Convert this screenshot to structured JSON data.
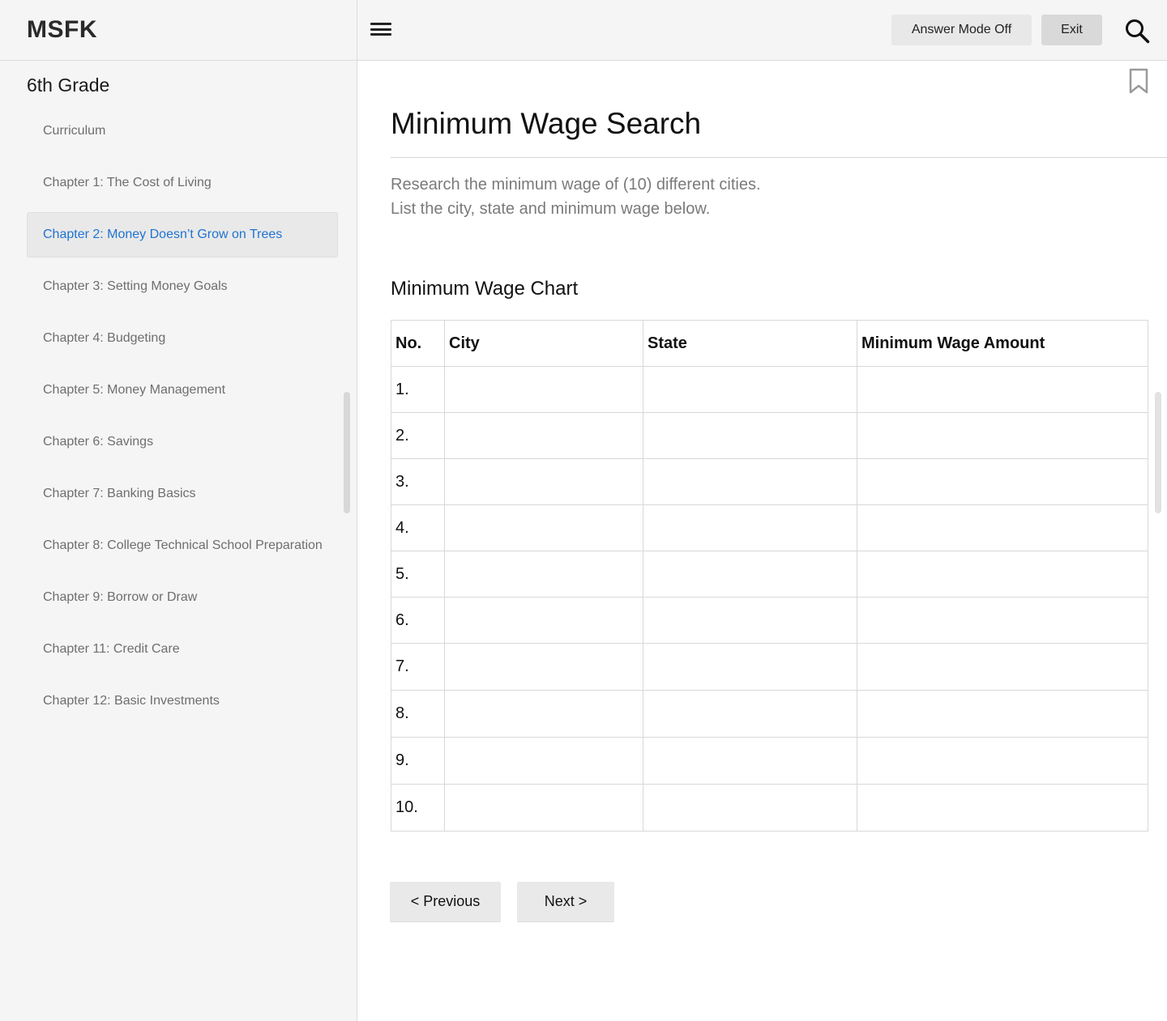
{
  "app": {
    "brand": "MSFK"
  },
  "sidebar": {
    "grade": "6th Grade",
    "items": [
      {
        "label": "Curriculum",
        "active": false
      },
      {
        "label": "Chapter 1: The Cost of Living",
        "active": false
      },
      {
        "label": "Chapter 2: Money Doesn’t Grow on Trees",
        "active": true
      },
      {
        "label": "Chapter 3: Setting Money Goals",
        "active": false
      },
      {
        "label": "Chapter 4: Budgeting",
        "active": false
      },
      {
        "label": "Chapter 5: Money Management",
        "active": false
      },
      {
        "label": "Chapter 6: Savings",
        "active": false
      },
      {
        "label": "Chapter 7: Banking Basics",
        "active": false
      },
      {
        "label": "Chapter 8: College Technical School Preparation",
        "active": false
      },
      {
        "label": "Chapter 9: Borrow or Draw",
        "active": false
      },
      {
        "label": "Chapter 11: Credit Care",
        "active": false
      },
      {
        "label": "Chapter 12: Basic Investments",
        "active": false
      }
    ]
  },
  "toolbar": {
    "answer_mode_label": "Answer Mode Off",
    "exit_label": "Exit"
  },
  "main": {
    "title": "Minimum Wage Search",
    "description_line1": "Research the minimum wage of (10) different cities.",
    "description_line2": "List the city, state and minimum wage below.",
    "section_title": "Minimum Wage Chart",
    "table": {
      "headers": [
        "No.",
        "City",
        "State",
        "Minimum Wage Amount"
      ],
      "rows": [
        [
          "1.",
          "",
          "",
          ""
        ],
        [
          "2.",
          "",
          "",
          ""
        ],
        [
          "3.",
          "",
          "",
          ""
        ],
        [
          "4.",
          "",
          "",
          ""
        ],
        [
          "5.",
          "",
          "",
          ""
        ],
        [
          "6.",
          "",
          "",
          ""
        ],
        [
          "7.",
          "",
          "",
          ""
        ],
        [
          "8.",
          "",
          "",
          ""
        ],
        [
          "9.",
          "",
          "",
          ""
        ],
        [
          "10.",
          "",
          "",
          ""
        ]
      ]
    },
    "prev_label": "< Previous",
    "next_label": "Next >"
  },
  "colors": {
    "active_link": "#1f74d1",
    "sidebar_bg": "#f5f5f5",
    "muted_text": "#7a7a7a"
  },
  "icons": [
    "menu-icon",
    "search-icon",
    "bookmark-icon"
  ]
}
